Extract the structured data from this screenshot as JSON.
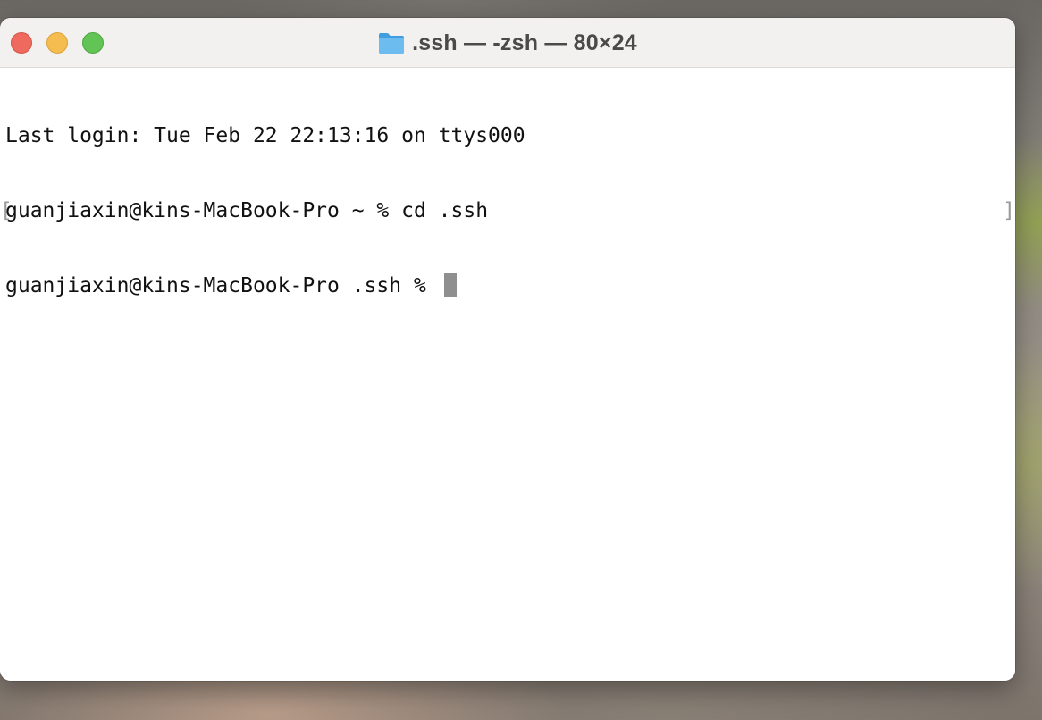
{
  "window": {
    "title": ".ssh — -zsh — 80×24",
    "title_icon": "folder-icon"
  },
  "colors": {
    "close": "#ee6a5f",
    "minimize": "#f5bd4f",
    "zoom": "#61c454",
    "folder": "#5aaee8"
  },
  "terminal": {
    "lines": [
      "Last login: Tue Feb 22 22:13:16 on ttys000",
      "guanjiaxin@kins-MacBook-Pro ~ % cd .ssh",
      "guanjiaxin@kins-MacBook-Pro .ssh % "
    ],
    "mark_glyph_left": "[",
    "mark_glyph_right": "]"
  }
}
